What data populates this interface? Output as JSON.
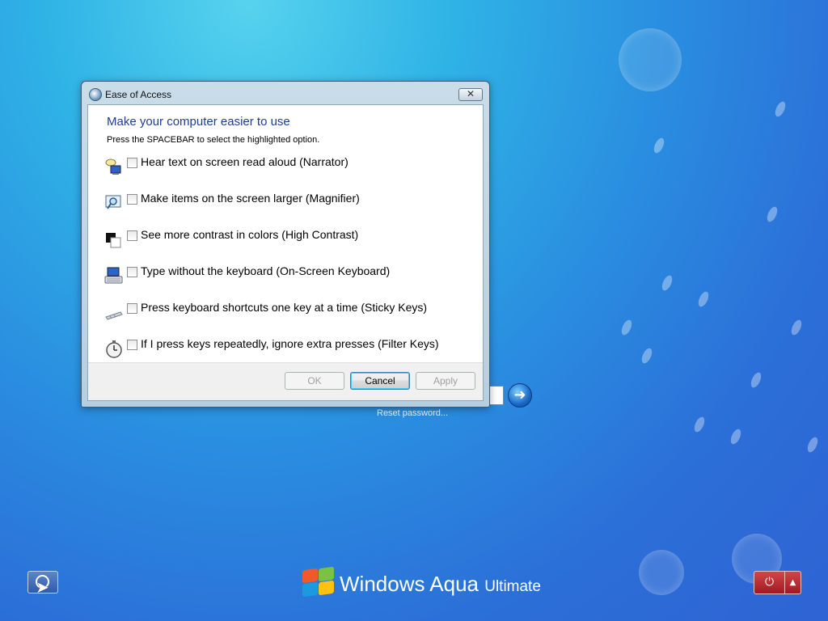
{
  "dialog": {
    "title": "Ease of Access",
    "close_glyph": "✕",
    "heading": "Make your computer easier to use",
    "instruction": "Press the SPACEBAR to select the highlighted option.",
    "options": [
      {
        "label": "Hear text on screen read aloud (Narrator)",
        "icon": "narrator-icon",
        "checked": false
      },
      {
        "label": "Make items on the screen larger (Magnifier)",
        "icon": "magnifier-icon",
        "checked": false
      },
      {
        "label": "See more contrast in colors (High Contrast)",
        "icon": "high-contrast-icon",
        "checked": false
      },
      {
        "label": "Type without the keyboard (On-Screen Keyboard)",
        "icon": "on-screen-keyboard-icon",
        "checked": false
      },
      {
        "label": "Press keyboard shortcuts one key at a time (Sticky Keys)",
        "icon": "sticky-keys-icon",
        "checked": false
      },
      {
        "label": "If I press keys repeatedly, ignore extra presses (Filter Keys)",
        "icon": "filter-keys-icon",
        "checked": false
      }
    ],
    "buttons": {
      "ok": "OK",
      "cancel": "Cancel",
      "apply": "Apply"
    }
  },
  "login": {
    "reset_password_link": "Reset password..."
  },
  "branding": {
    "product": "Windows Aqua",
    "edition": "Ultimate"
  },
  "colors": {
    "heading": "#1e3d91",
    "power": "#b8262b",
    "desktop": "#2a8fe0"
  }
}
